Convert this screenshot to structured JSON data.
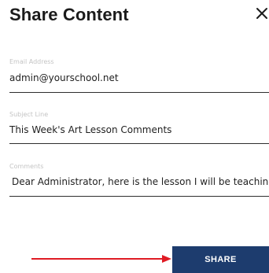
{
  "dialog": {
    "title": "Share Content",
    "close_icon": "close-icon"
  },
  "fields": {
    "email": {
      "label": "Email Address",
      "value": "admin@yourschool.net"
    },
    "subject": {
      "label": "Subject Line",
      "value": "This Week's Art Lesson Comments"
    },
    "comments": {
      "label": "Comments",
      "value": "Dear Administrator, here is the lesson I will be teaching this week."
    }
  },
  "actions": {
    "share_label": "SHARE"
  },
  "annotation": {
    "arrow_icon": "red-arrow-icon"
  },
  "colors": {
    "share_button_bg": "#1d3c6e",
    "arrow": "#e01b24",
    "field_underline": "#2e2e2e",
    "field_label": "#c4c4c4"
  }
}
